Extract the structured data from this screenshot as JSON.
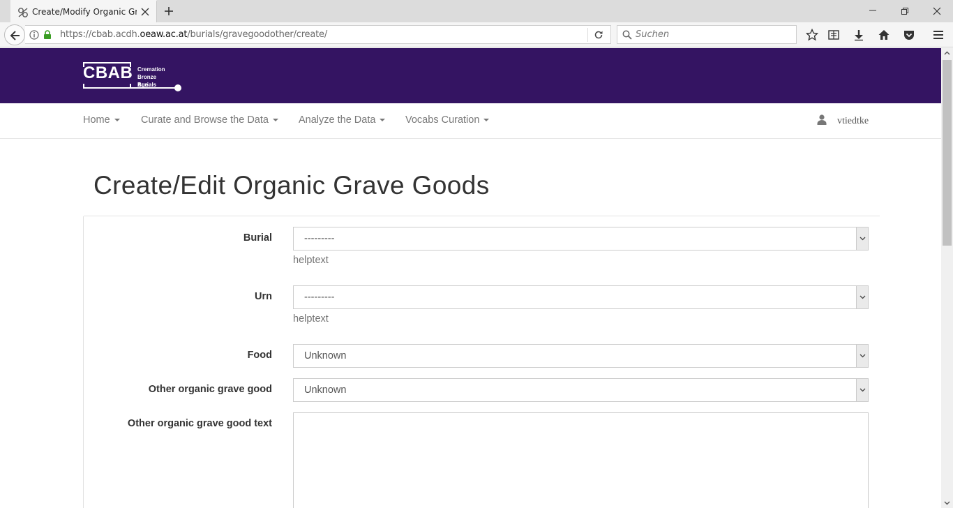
{
  "browser": {
    "tab_title": "Create/Modify Organic Grave Goods",
    "url_prefix": "https://cbab.acdh.",
    "url_domain": "oeaw.ac.at",
    "url_path": "/burials/gravegoodother/create/",
    "search_placeholder": "Suchen"
  },
  "site": {
    "brand": "CBAB",
    "brand_sub": [
      "Cremation",
      "Bronze Age",
      "Burials"
    ],
    "brand_color": "#341462",
    "nav": [
      "Home",
      "Curate and Browse the Data",
      "Analyze the Data",
      "Vocabs Curation"
    ],
    "user": "vtiedtke"
  },
  "page": {
    "title": "Create/Edit Organic Grave Goods"
  },
  "form": {
    "burial": {
      "label": "Burial",
      "value": "---------",
      "help": "helptext"
    },
    "urn": {
      "label": "Urn",
      "value": "---------",
      "help": "helptext"
    },
    "food": {
      "label": "Food",
      "value": "Unknown"
    },
    "other": {
      "label": "Other organic grave good",
      "value": "Unknown"
    },
    "other_text": {
      "label": "Other organic grave good text",
      "value": ""
    }
  }
}
